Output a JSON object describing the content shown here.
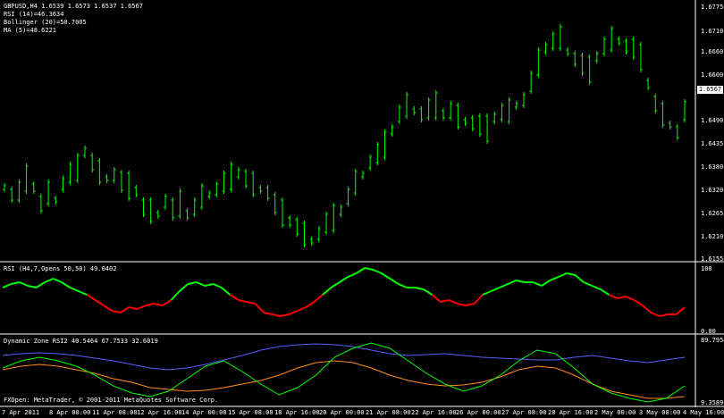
{
  "chart": {
    "info": [
      "GBPUSD,H4  1.6539 1.6573 1.6537 1.6567",
      "RSI (14)=46.3634",
      "Bollinger (20)=50.7005",
      "MA (5)=48.6221"
    ],
    "y_labels": [
      "1.6775",
      "1.6710",
      "1.6660",
      "1.6600",
      "1.6490",
      "1.6435",
      "1.6380",
      "1.6320",
      "1.6265",
      "1.6210",
      "1.6155"
    ],
    "current_price": "1.6567",
    "colors": {
      "bull": "#00ff00",
      "bear": "#ff0000",
      "blue": "#5b5bff",
      "orange": "#ff8c1a",
      "background": "#000000",
      "grid": "#ffffff"
    }
  },
  "rsi_panel": {
    "label": "RSI (H4,7,Opens 50,50) 49.0402",
    "y_labels": [
      "100",
      "0.00"
    ]
  },
  "dz_panel": {
    "label": "Dynamic Zone RSI2 40.5464 67.7533 32.6019",
    "y_labels": [
      "89.7958",
      "9.3589"
    ],
    "copyright": "FXOpen: MetaTrader, © 2001-2011 MetaQuotes Software Corp."
  },
  "x_labels": [
    "7 Apr 2011",
    "8 Apr 00:00",
    "11 Apr 08:00",
    "12 Apr 16:00",
    "14 Apr 00:00",
    "15 Apr 08:00",
    "18 Apr 16:00",
    "20 Apr 00:00",
    "21 Apr 08:00",
    "22 Apr 16:00",
    "26 Apr 00:00",
    "27 Apr 08:00",
    "28 Apr 16:00",
    "2 May 00:00",
    "3 May 08:00",
    "4 May 16:00"
  ]
}
